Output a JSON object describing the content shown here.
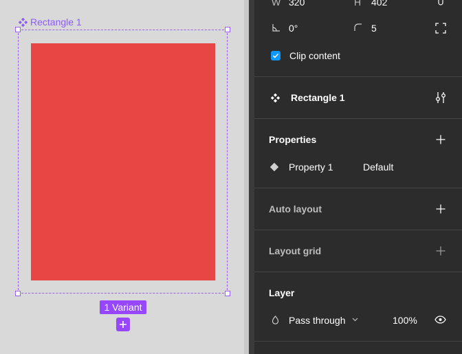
{
  "canvas": {
    "frame_label": "Rectangle 1",
    "variant_pill": "1 Variant"
  },
  "panel": {
    "dims": {
      "w_label": "W",
      "w_value": "320",
      "h_label": "H",
      "h_value": "402"
    },
    "rotation": "0°",
    "corner_radius": "5",
    "clip_content": {
      "label": "Clip content",
      "checked": true
    },
    "component": {
      "name": "Rectangle 1"
    },
    "properties": {
      "title": "Properties",
      "items": [
        {
          "name": "Property 1",
          "value": "Default"
        }
      ]
    },
    "auto_layout": {
      "title": "Auto layout"
    },
    "layout_grid": {
      "title": "Layout grid"
    },
    "layer": {
      "title": "Layer",
      "blend_mode": "Pass through",
      "opacity": "100%"
    }
  },
  "colors": {
    "canvas_bg": "#d9d9d9",
    "panel_bg": "#2c2c2c",
    "selection_purple": "#9b5cf6",
    "rect_fill": "#e84545",
    "checkbox_blue": "#0d99ff"
  }
}
